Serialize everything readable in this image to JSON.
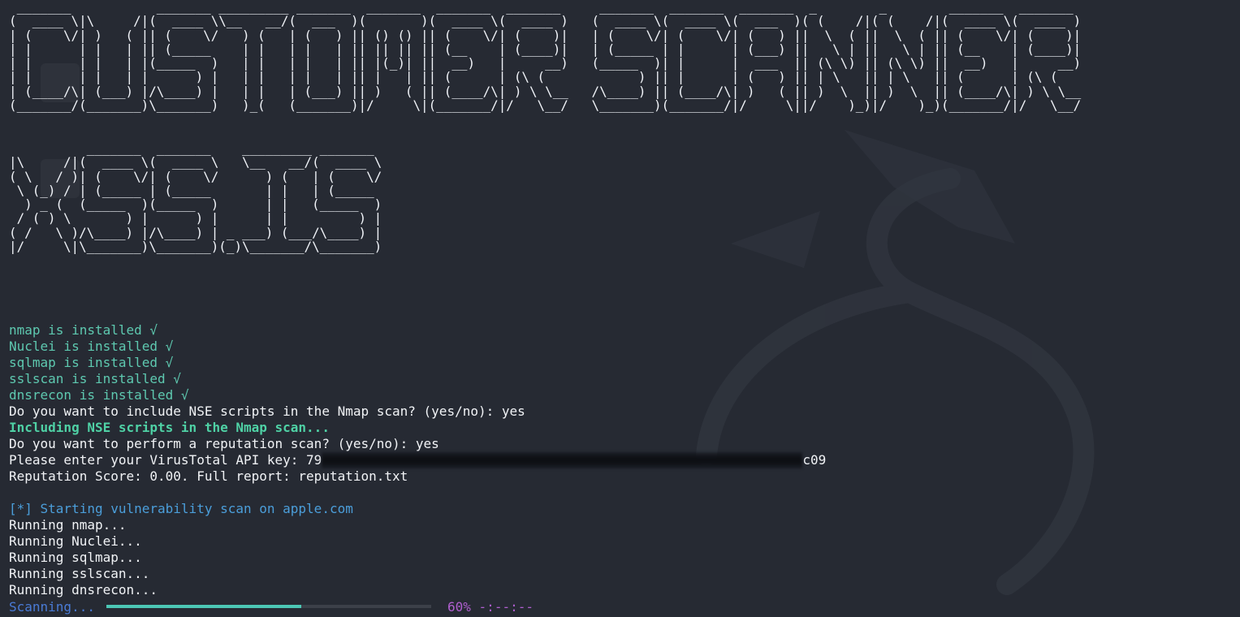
{
  "banner": {
    "line1": " _______           _______ _________ _______  _______  _______  _______     _______  _______  _______  _        _        _______  _______ \n(  ____ \\|\\     /|(  ____ \\\\__   __/(  ___  )(       )(  ____ \\(  ____ )   (  ____ \\(  ____ \\(  ___  )( (    /|( (    /|(  ____ \\(  ____ )\n| (    \\/| )   ( || (    \\/   ) (   | (   ) || () () || (    \\/| (    )|   | (    \\/| (    \\/| (   ) ||  \\  ( ||  \\  ( || (    \\/| (    )|\n| |      | |   | || (_____    | |   | |   | || || || || (__    | (____)|   | (_____ | |      | (___) ||   \\ | ||   \\ | || (__    | (____)|\n| |      | |   | |(_____  )   | |   | |   | || |(_)| ||  __)   |     __)   (_____  )| |      |  ___  || (\\ \\) || (\\ \\) ||  __)   |     __)\n| |      | |   | |      ) |   | |   | |   | || |   | || (      | (\\ (            ) || |      | (   ) || | \\   || | \\   || (      | (\\ (   \n| (____/\\| (___) |/\\____) |   | |   | (___) || )   ( || (____/\\| ) \\ \\__   /\\____) || (____/\\| )   ( || )  \\  || )  \\  || (____/\\| ) \\ \\__\n(_______/(_______)\\_______)   )_(   (_______)|/     \\|(_______/|/   \\__/   \\_______)(_______/|/     \\||/    )_)|/    )_)(_______/|/   \\__/",
    "line2": "          _______  _______    _________ _______ \n|\\     /|(  ____ \\(  ____ \\   \\__   __/(  ____ \\\n( \\   / )| (    \\/| (    \\/      ) (   | (    \\/\n \\ (_) / | (_____ | (_____       | |   | (_____ \n  ) _ (  (_____  )(_____  )      | |   (_____  )\n / ( ) \\       ) |      ) |      | |         ) |\n( /   \\ )/\\____) |/\\____) | _ ___) (___/\\____) |\n|/     \\|\\_______)\\_______)(_)\\_______/\\_______)"
  },
  "output": {
    "installed": [
      "nmap is installed √",
      "Nuclei is installed √",
      "sqlmap is installed √",
      "sslscan is installed √",
      "dnsrecon is installed √"
    ],
    "nse_prompt": "Do you want to include NSE scripts in the Nmap scan? (yes/no): yes",
    "nse_confirm": "Including NSE scripts in the Nmap scan...",
    "rep_prompt": "Do you want to perform a reputation scan? (yes/no): yes",
    "api_prompt": "Please enter your VirusTotal API key: 79",
    "api_tail": "c09",
    "rep_score": "Reputation Score: 0.00. Full report: reputation.txt",
    "vuln_start": "[*] Starting vulnerability scan on apple.com",
    "running": [
      "Running nmap...",
      "Running Nuclei...",
      "Running sqlmap...",
      "Running sslscan...",
      "Running dnsrecon..."
    ]
  },
  "progress": {
    "label": "Scanning...",
    "value": 0.6,
    "percent_text": "60%",
    "eta": "-:--:--"
  },
  "colors": {
    "background": "#262a33",
    "success": "#5ec9b0",
    "info": "#4b9eda",
    "progress_fill": "#4cc7b5",
    "percent": "#b05fd0"
  }
}
